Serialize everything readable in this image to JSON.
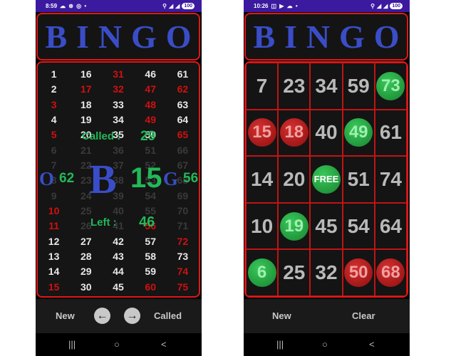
{
  "status_left": {
    "time": "8:59",
    "icons": "☁ ⊗ ◎ •",
    "battery": "100"
  },
  "status_right": {
    "time": "10:26",
    "icons": "◫ ▶ ☁ •",
    "battery": "100"
  },
  "header_letters": [
    "B",
    "I",
    "N",
    "G",
    "O"
  ],
  "called_board": {
    "columns": [
      [
        1,
        2,
        3,
        4,
        5,
        6,
        7,
        8,
        9,
        10,
        11,
        12,
        13,
        14,
        15
      ],
      [
        16,
        17,
        18,
        19,
        20,
        21,
        22,
        23,
        24,
        25,
        26,
        27,
        28,
        29,
        30
      ],
      [
        31,
        32,
        33,
        34,
        35,
        36,
        37,
        38,
        39,
        40,
        41,
        42,
        43,
        44,
        45
      ],
      [
        46,
        47,
        48,
        49,
        50,
        51,
        52,
        53,
        54,
        55,
        56,
        57,
        58,
        59,
        60
      ],
      [
        61,
        62,
        63,
        64,
        65,
        66,
        67,
        68,
        69,
        70,
        71,
        72,
        73,
        74,
        75
      ]
    ],
    "called_numbers": [
      3,
      5,
      10,
      11,
      15,
      17,
      31,
      32,
      47,
      48,
      49,
      56,
      60,
      62,
      65,
      72,
      74,
      75
    ]
  },
  "stats": {
    "called_label": "Called :",
    "called_count": "29",
    "left_label": "Left :",
    "left_count": "46"
  },
  "recent_calls": {
    "previous_letter": "O",
    "previous_number": "62",
    "current_letter": "B",
    "current_number": "15",
    "next_letter": "G",
    "next_number": "56"
  },
  "left_toolbar": {
    "new_label": "New",
    "prev_icon": "arrow-left-icon",
    "next_icon": "arrow-right-icon",
    "called_label": "Called"
  },
  "right_toolbar": {
    "new_label": "New",
    "clear_label": "Clear"
  },
  "card": {
    "free_label": "FREE",
    "cells": [
      [
        "7",
        "plain"
      ],
      [
        "23",
        "plain"
      ],
      [
        "34",
        "plain"
      ],
      [
        "59",
        "plain"
      ],
      [
        "73",
        "green"
      ],
      [
        "15",
        "red"
      ],
      [
        "18",
        "red"
      ],
      [
        "40",
        "plain"
      ],
      [
        "49",
        "green"
      ],
      [
        "61",
        "plain"
      ],
      [
        "14",
        "plain"
      ],
      [
        "20",
        "plain"
      ],
      [
        "FREE",
        "free"
      ],
      [
        "51",
        "plain"
      ],
      [
        "74",
        "plain"
      ],
      [
        "10",
        "plain"
      ],
      [
        "19",
        "green"
      ],
      [
        "45",
        "plain"
      ],
      [
        "54",
        "plain"
      ],
      [
        "64",
        "plain"
      ],
      [
        "6",
        "green"
      ],
      [
        "25",
        "plain"
      ],
      [
        "32",
        "plain"
      ],
      [
        "50",
        "red"
      ],
      [
        "68",
        "red"
      ]
    ]
  },
  "nav_icons": {
    "recents": "|||",
    "home": "○",
    "back": "<"
  },
  "colors": {
    "status_bar": "#3b1aa0",
    "accent_blue": "#3a4dc8",
    "called_red": "#d01010",
    "chip_green": "#22b858",
    "border_red": "#e01818"
  }
}
